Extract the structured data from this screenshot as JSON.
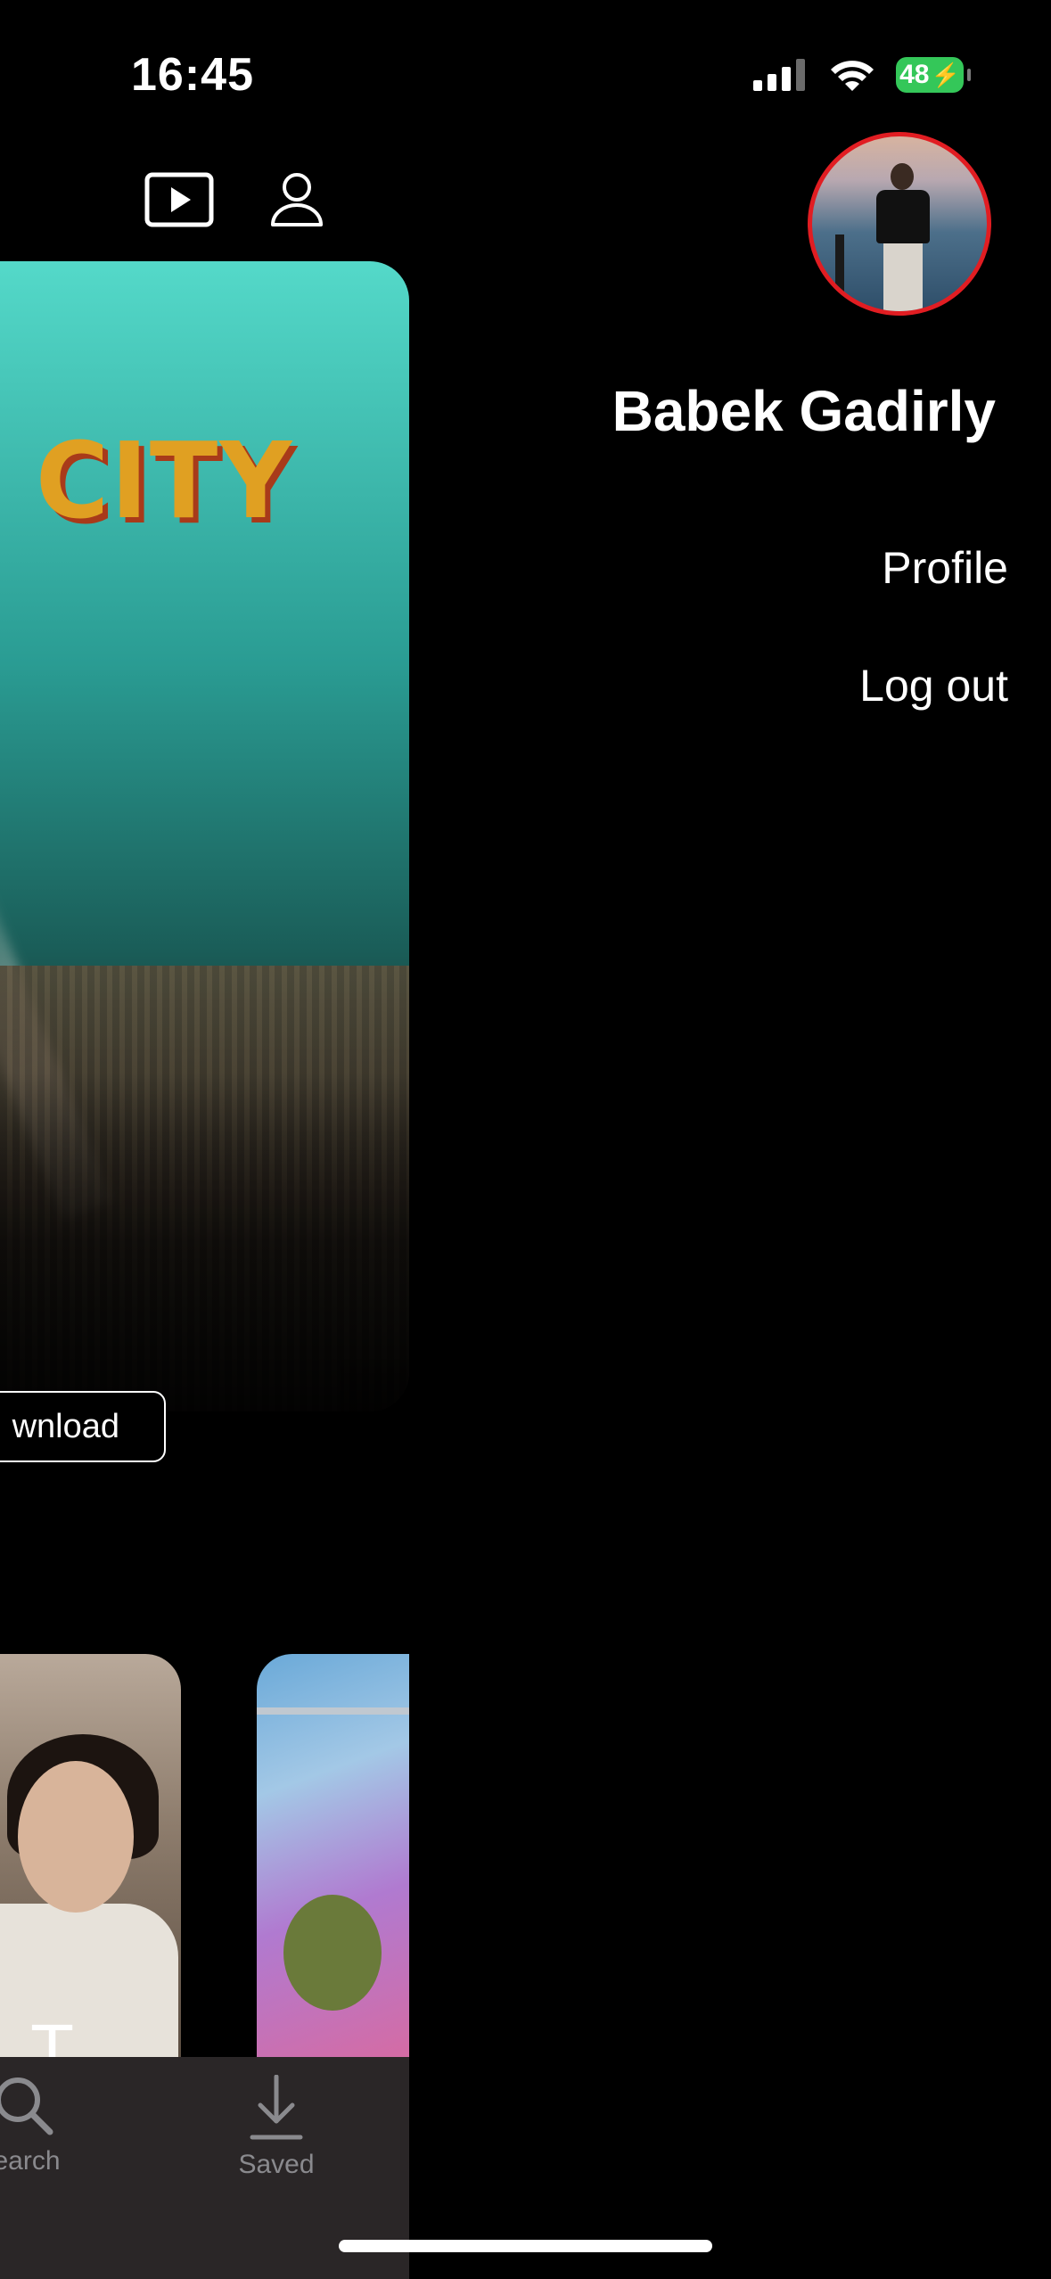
{
  "status_bar": {
    "time": "16:45",
    "battery": "48",
    "icons": [
      "cellular-signal-icon",
      "wifi-icon",
      "battery-charging-icon"
    ]
  },
  "content": {
    "top_icons": [
      "play-icon",
      "person-icon"
    ],
    "hero": {
      "title": "CITY",
      "download_label": "wnload"
    },
    "posters": [
      {
        "letters": "S T"
      },
      {
        "letters": ""
      }
    ],
    "bottom_nav": {
      "search_label": "earch",
      "saved_label": "Saved"
    }
  },
  "menu": {
    "user_name": "Babek Gadirly",
    "items": [
      {
        "label": "Profile"
      },
      {
        "label": "Log out"
      }
    ]
  },
  "colors": {
    "background": "#000000",
    "avatar_ring": "#e11d22",
    "battery": "#34c759",
    "hero_title": "#e0a022",
    "tab_inactive": "#8a8a8e"
  }
}
